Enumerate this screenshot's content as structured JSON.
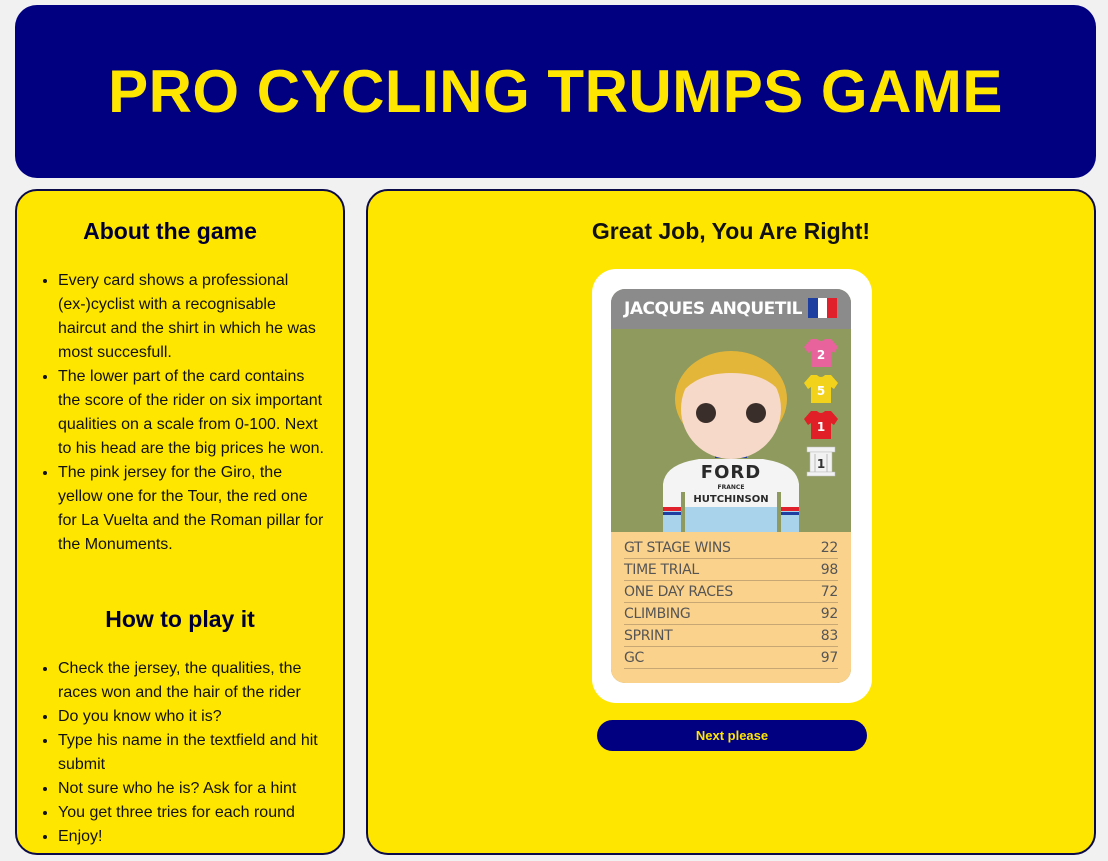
{
  "header": {
    "title": "PRO CYCLING TRUMPS GAME"
  },
  "about": {
    "title": "About the game",
    "items": [
      "Every card shows a professional (ex-)cyclist with a recognisable haircut and the shirt in which he was most succesfull.",
      "The lower part of the card contains the score of the rider on six important qualities on a scale from 0-100. Next to his head are the big prices he won.",
      "The pink jersey for the Giro, the yellow one for the Tour, the red one for La Vuelta and the Roman pillar for the Monuments."
    ]
  },
  "how": {
    "title": "How to play it",
    "items": [
      "Check the jersey, the qualities, the races won and the hair of the rider",
      "Do you know who it is?",
      "Type his name in the textfield and hit submit",
      "Not sure who he is? Ask for a hint",
      "You get three tries for each round",
      "Enjoy!"
    ]
  },
  "result": {
    "message": "Great Job, You Are Right!"
  },
  "card": {
    "name": "JACQUES ANQUETIL",
    "flag_colors": [
      "#1f3fa0",
      "#ffffff",
      "#e0202a"
    ],
    "shirt_text": {
      "sponsor": "FORD",
      "line2": "FRANCE",
      "line3": "HUTCHINSON"
    },
    "wins": [
      {
        "label": "2",
        "type": "giro",
        "color": "#e8629c"
      },
      {
        "label": "5",
        "type": "tour",
        "color": "#f3d21c"
      },
      {
        "label": "1",
        "type": "vuelta",
        "color": "#e01f26"
      },
      {
        "label": "1",
        "type": "monuments",
        "color": "#f2f2f2"
      }
    ],
    "stats": [
      {
        "label": "GT STAGE WINS",
        "value": "22"
      },
      {
        "label": "TIME TRIAL",
        "value": "98"
      },
      {
        "label": "ONE DAY RACES",
        "value": "72"
      },
      {
        "label": "CLIMBING",
        "value": "92"
      },
      {
        "label": "SPRINT",
        "value": "83"
      },
      {
        "label": "GC",
        "value": "97"
      }
    ]
  },
  "next_button": {
    "label": "Next please"
  }
}
